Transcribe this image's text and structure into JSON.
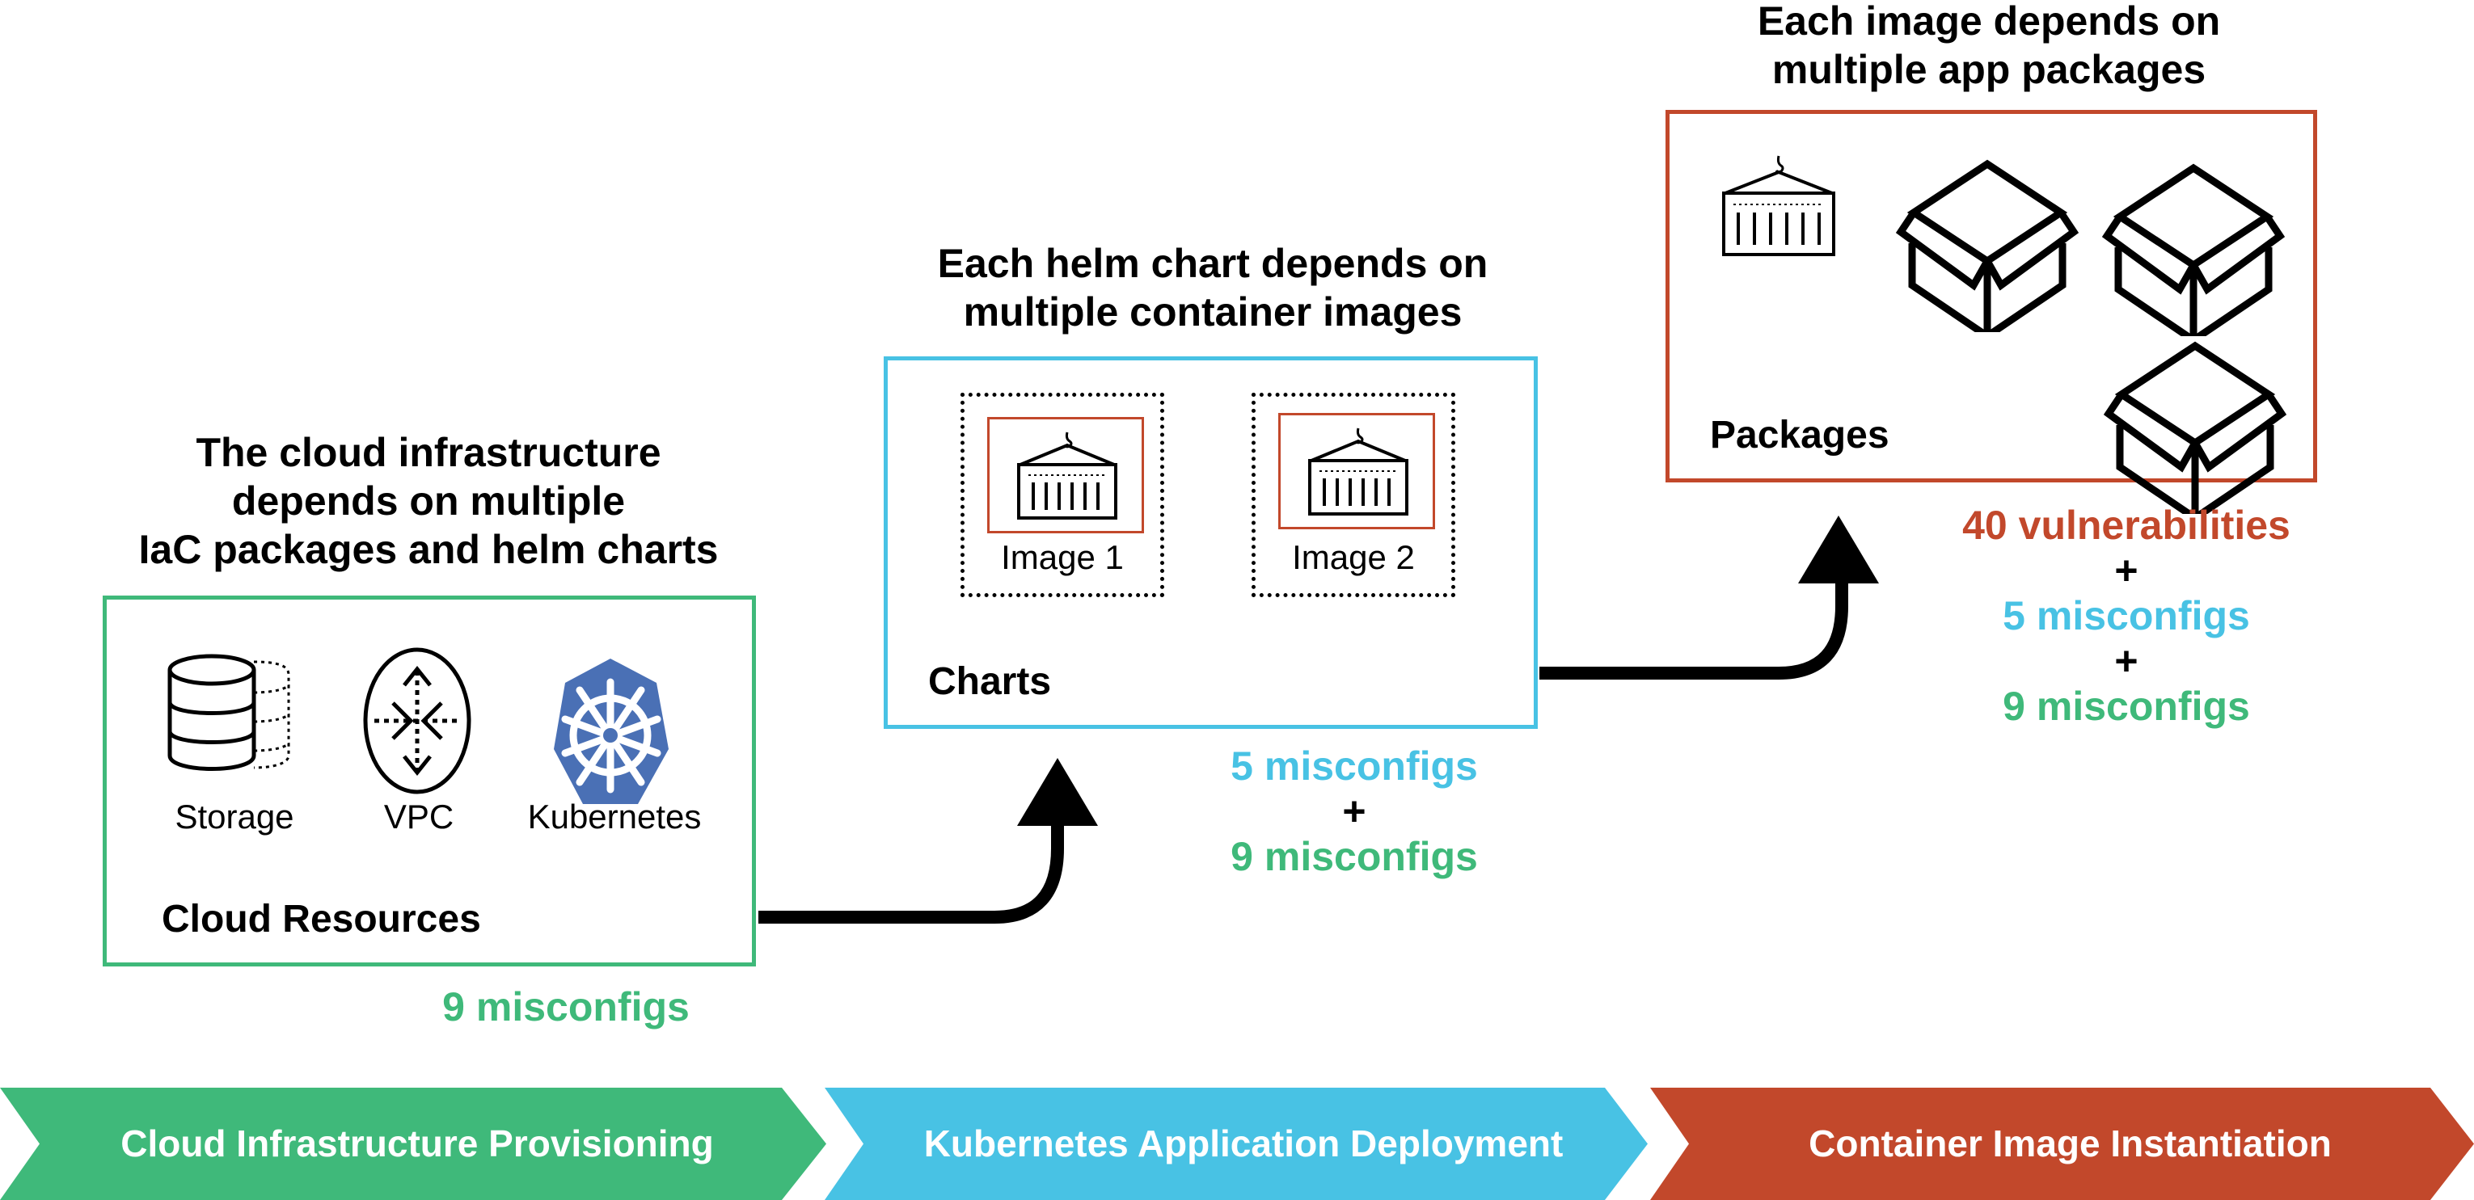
{
  "colors": {
    "green": "#3fb97a",
    "blue": "#48c2e4",
    "red": "#c2482b",
    "kubernetes_blue": "#4a70b5"
  },
  "cloud": {
    "heading_lines": [
      "The cloud infrastructure",
      "depends on multiple",
      "IaC packages and helm charts"
    ],
    "box_label": "Cloud Resources",
    "icons": [
      {
        "name": "storage-icon",
        "label": "Storage"
      },
      {
        "name": "vpc-icon",
        "label": "VPC"
      },
      {
        "name": "kubernetes-icon",
        "label": "Kubernetes"
      }
    ],
    "metrics": [
      "9 misconfigs"
    ]
  },
  "charts": {
    "heading_lines": [
      "Each helm chart depends on",
      "multiple container images"
    ],
    "box_label": "Charts",
    "images": [
      {
        "label": "Image 1"
      },
      {
        "label": "Image 2"
      }
    ],
    "metrics": [
      "5 misconfigs",
      "+",
      "9 misconfigs"
    ]
  },
  "packages": {
    "heading_lines": [
      "Each image depends on",
      "multiple app packages"
    ],
    "box_label": "Packages",
    "icons": [
      "container-icon",
      "package-box-icon",
      "package-box-icon",
      "package-box-icon"
    ],
    "metrics": [
      "40 vulnerabilities",
      "+",
      "5 misconfigs",
      "+",
      "9 misconfigs"
    ]
  },
  "stages": [
    {
      "label": "Cloud Infrastructure Provisioning",
      "color": "#3fb97a"
    },
    {
      "label": "Kubernetes Application Deployment",
      "color": "#48c2e4"
    },
    {
      "label": "Container Image Instantiation",
      "color": "#c2482b"
    }
  ]
}
